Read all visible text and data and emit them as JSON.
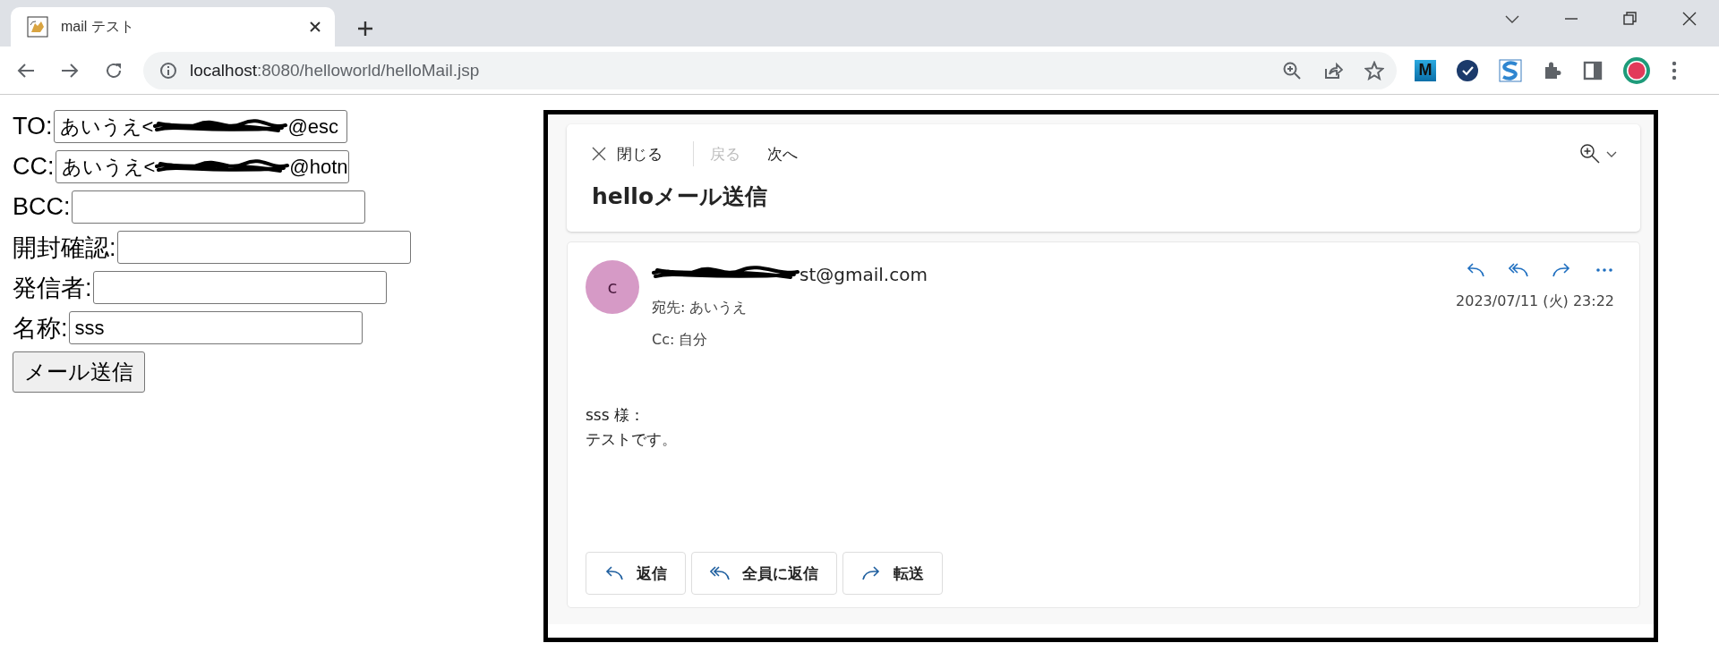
{
  "browser": {
    "tab": {
      "title": "mail テスト",
      "selected": true
    },
    "url": {
      "host": "localhost",
      "path": ":8080/helloworld/helloMail.jsp"
    },
    "extensions": [
      {
        "kind": "letter",
        "label": "M"
      },
      {
        "kind": "check"
      },
      {
        "kind": "swoosh"
      },
      {
        "kind": "puzzle"
      },
      {
        "kind": "sidebar"
      },
      {
        "kind": "avatar"
      }
    ]
  },
  "form": {
    "fields": [
      {
        "label": "TO:",
        "value_start": "あいうえ<",
        "value_end": "@esc",
        "redacted": true
      },
      {
        "label": "CC:",
        "value_start": "あいうえ<",
        "value_end": "@hotn",
        "redacted": true
      },
      {
        "label": "BCC:",
        "redacted": false
      },
      {
        "label": "開封確認:",
        "redacted": false
      },
      {
        "label": "発信者:",
        "redacted": false
      },
      {
        "label": "名称:",
        "value_start": "sss",
        "redacted": false
      }
    ],
    "submit": "メール送信"
  },
  "viewer": {
    "toolbar": {
      "close": "閉じる",
      "back": {
        "label": "戻る",
        "disabled": true
      },
      "next": {
        "label": "次へ",
        "disabled": false
      }
    },
    "subject": "helloメール送信",
    "message": {
      "avatar_initial": "c",
      "sender_end": "st@gmail.com",
      "to_label": "宛先:",
      "to": "あいうえ",
      "cc_label": "Cc:",
      "cc": "自分",
      "date": "2023/07/11 (火) 23:22",
      "body": [
        "sss 様：",
        "テストです。"
      ],
      "actions": [
        {
          "kind": "reply",
          "label": "返信"
        },
        {
          "kind": "reply_all",
          "label": "全員に返信"
        },
        {
          "kind": "forward",
          "label": "転送"
        }
      ]
    }
  }
}
